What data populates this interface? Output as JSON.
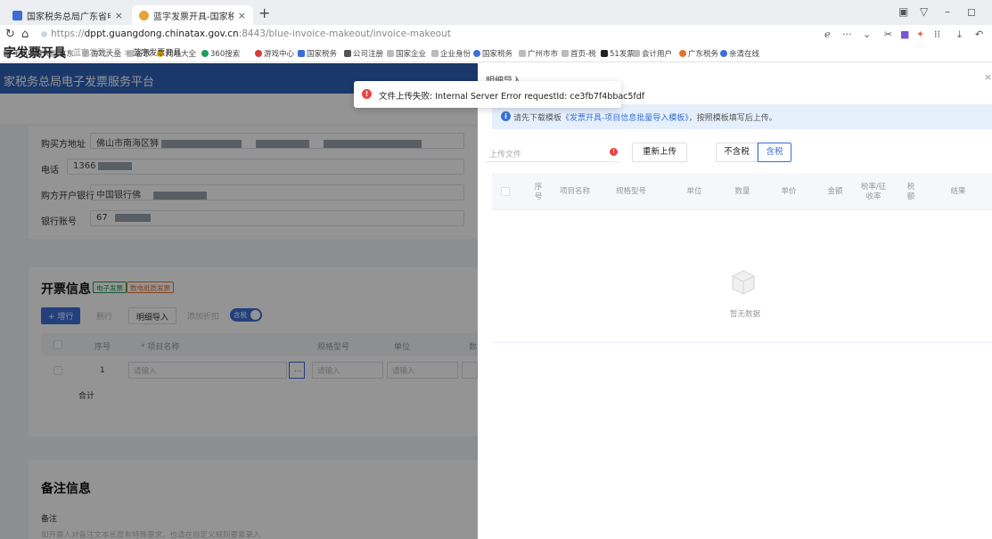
{
  "browser": {
    "tabs": [
      {
        "label": "国家税务总局广东省电子税务",
        "active": false,
        "favicon_color": "#3c6fd6"
      },
      {
        "label": "蓝字发票开具-国家税务总局",
        "active": true,
        "favicon_color": "#e6a23c"
      }
    ],
    "url_prefix": "https://",
    "url_host": "dppt.guangdong.chinatax.gov.cn",
    "url_rest": ":8443/blue-invoice-makeout/invoice-makeout",
    "bookmarks": [
      "手机收藏夹",
      "京东",
      "游戏大全",
      "谷歌",
      "网址大全",
      "360搜索",
      "游戏中心",
      "国家税务",
      "公司注册",
      "国家企业",
      "企业身份",
      "国家税务",
      "广州市市",
      "首页-税",
      "51发票",
      "会计用户",
      "广东税务",
      "亲清在线"
    ]
  },
  "app": {
    "header_title": "家税务总局电子发票服务平台",
    "page_title": "字发票开具",
    "breadcrumb_parent": "蓝字发票开具",
    "breadcrumb_current": "蓝字发票开具",
    "buyer": {
      "address_label": "购买方地址",
      "address_value": "佛山市南海区狮",
      "phone_label": "电话",
      "phone_value": "1366",
      "bank_label": "购方开户银行",
      "bank_value": "中国银行佛",
      "account_label": "银行账号",
      "account_value": "67"
    },
    "invoice_section_title": "开票信息",
    "tag_electronic": "电子发票",
    "tag_special": "数电纸质发票",
    "btn_add_row": "+ 增行",
    "btn_delete": "删行",
    "btn_detail_import": "明细导入",
    "btn_add_discount": "添加折扣",
    "toggle_label": "含税",
    "table_headers": [
      "序号",
      "* 项目名称",
      "规格型号",
      "单位",
      "数"
    ],
    "row_index": "1",
    "placeholder": "请输入",
    "sum_label": "合计",
    "remark_title": "备注信息",
    "remark_label": "备注",
    "remark_placeholder": "如开票人对备注文本长度有特殊要求，也请在自定义规则要素录入"
  },
  "drawer": {
    "title": "明细导入",
    "info_prefix": "请先下载模板",
    "info_link": "《发票开具-项目信息批量导入模板》",
    "info_suffix": "，按照模板填写后上传。",
    "upload_placeholder": "上传文件",
    "btn_reupload": "重新上传",
    "seg_notax": "不含税",
    "seg_tax": "含税",
    "table_headers": [
      "序号",
      "项目名称",
      "规格型号",
      "单位",
      "数量",
      "单价",
      "金额",
      "税率/征收率",
      "税额",
      "结果"
    ],
    "empty_text": "暂无数据"
  },
  "toast": {
    "message": "文件上传失败: Internal Server Error requestId: ce3fb7f4bbac5fdf",
    "status_color": "#e64545"
  },
  "colors": {
    "primary": "#3b6fd6",
    "header_blue": "#2f61b8",
    "error": "#e64545"
  }
}
